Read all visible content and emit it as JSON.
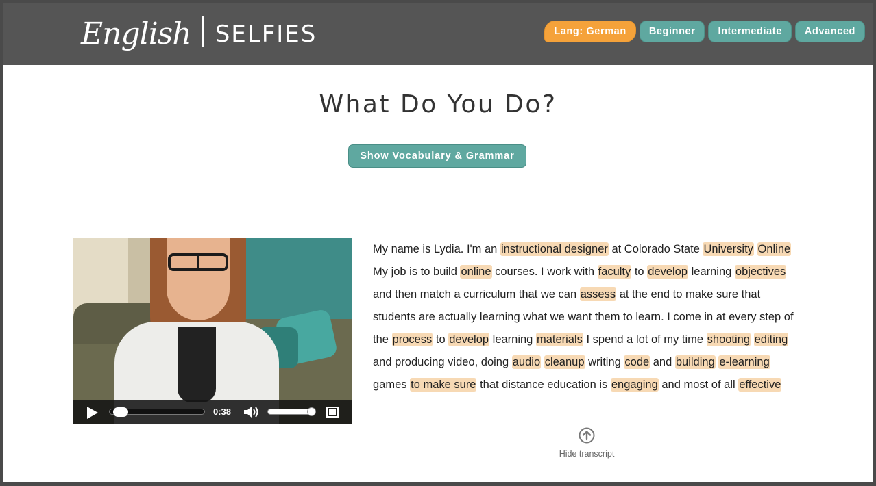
{
  "header": {
    "logo_script": "English",
    "logo_caps": "SELFIES",
    "nav": [
      {
        "label": "Lang: German",
        "kind": "lang",
        "color": "#f5a23a"
      },
      {
        "label": "Beginner",
        "kind": "level",
        "color": "#5fa8a0"
      },
      {
        "label": "Intermediate",
        "kind": "level",
        "color": "#5fa8a0"
      },
      {
        "label": "Advanced",
        "kind": "level",
        "color": "#5fa8a0"
      }
    ]
  },
  "main": {
    "title": "What Do You Do?",
    "vocab_button": "Show Vocabulary & Grammar",
    "video": {
      "time": "0:38",
      "progress": 0.05,
      "volume": 0.9
    },
    "transcript": [
      {
        "t": "My name is Lydia. I'm an "
      },
      {
        "t": "instructional designer",
        "hl": true
      },
      {
        "t": " at Colorado State "
      },
      {
        "t": "University",
        "hl": true
      },
      {
        "t": " "
      },
      {
        "t": "Online",
        "hl": true
      },
      {
        "t": " My job is to build "
      },
      {
        "t": "online",
        "hl": true
      },
      {
        "t": " courses. I work with "
      },
      {
        "t": "faculty",
        "hl": true
      },
      {
        "t": " to "
      },
      {
        "t": "develop",
        "hl": true
      },
      {
        "t": " learning "
      },
      {
        "t": "objectives",
        "hl": true
      },
      {
        "t": " and then match a curriculum that we can "
      },
      {
        "t": "assess",
        "hl": true
      },
      {
        "t": " at the end to make sure that students are actually learning what we want them to learn. I come in at every step of the "
      },
      {
        "t": "process",
        "hl": true
      },
      {
        "t": " to "
      },
      {
        "t": "develop",
        "hl": true
      },
      {
        "t": " learning "
      },
      {
        "t": "materials",
        "hl": true
      },
      {
        "t": " I spend a lot of my time "
      },
      {
        "t": "shooting",
        "hl": true
      },
      {
        "t": " "
      },
      {
        "t": "editing",
        "hl": true
      },
      {
        "t": " and producing video, doing "
      },
      {
        "t": "audio",
        "hl": true
      },
      {
        "t": " "
      },
      {
        "t": "cleanup",
        "hl": true
      },
      {
        "t": " writing "
      },
      {
        "t": "code",
        "hl": true
      },
      {
        "t": " and "
      },
      {
        "t": "building",
        "hl": true
      },
      {
        "t": " "
      },
      {
        "t": "e-learning",
        "hl": true
      },
      {
        "t": " games "
      },
      {
        "t": "to make sure",
        "hl": true
      },
      {
        "t": " that distance education is "
      },
      {
        "t": "engaging",
        "hl": true
      },
      {
        "t": " and most of all "
      },
      {
        "t": "effective",
        "hl": true
      }
    ],
    "hide_transcript": "Hide transcript"
  },
  "icons": {
    "play": "play-icon",
    "volume": "volume-icon",
    "fullscreen": "fullscreen-icon",
    "hide": "arrow-up-circle-icon"
  }
}
